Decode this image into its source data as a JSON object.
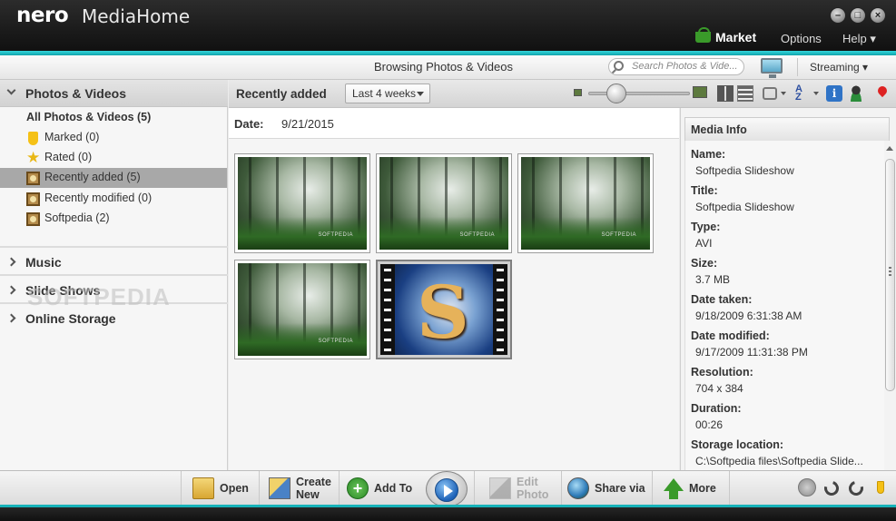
{
  "app": {
    "logo": "nero",
    "name": "MediaHome"
  },
  "menu": {
    "market": "Market",
    "options": "Options",
    "help": "Help ▾"
  },
  "header": {
    "breadcrumb": "Browsing Photos & Videos",
    "search_placeholder": "Search Photos & Vide...",
    "streaming": "Streaming ▾"
  },
  "sidebar": {
    "photos_videos": "Photos & Videos",
    "items": [
      {
        "label": "All Photos & Videos (5)",
        "icon": "none"
      },
      {
        "label": "Marked (0)",
        "icon": "tag-icon"
      },
      {
        "label": "Rated (0)",
        "icon": "star-icon"
      },
      {
        "label": "Recently added (5)",
        "icon": "album-icon",
        "selected": true
      },
      {
        "label": "Recently modified (0)",
        "icon": "album-icon"
      },
      {
        "label": "Softpedia (2)",
        "icon": "album-icon"
      }
    ],
    "music": "Music",
    "slide_shows": "Slide Shows",
    "online_storage": "Online Storage",
    "watermark": "SOFTPEDIA"
  },
  "toolbar": {
    "title": "Recently added",
    "period": "Last 4 weeks"
  },
  "main": {
    "date_label": "Date:",
    "date_value": "9/21/2015",
    "thumb_tag": "SOFTPEDIA"
  },
  "info": {
    "title": "Media Info",
    "fields": [
      {
        "key": "Name:",
        "value": "Softpedia Slideshow"
      },
      {
        "key": "Title:",
        "value": "Softpedia Slideshow"
      },
      {
        "key": "Type:",
        "value": "AVI"
      },
      {
        "key": "Size:",
        "value": "3.7 MB"
      },
      {
        "key": "Date taken:",
        "value": "9/18/2009 6:31:38 AM"
      },
      {
        "key": "Date modified:",
        "value": "9/17/2009 11:31:38 PM"
      },
      {
        "key": "Resolution:",
        "value": "704 x 384"
      },
      {
        "key": "Duration:",
        "value": "00:26"
      },
      {
        "key": "Storage location:",
        "value": "C:\\Softpedia files\\Softpedia Slide..."
      }
    ]
  },
  "bottom": {
    "open": "Open",
    "create_1": "Create",
    "create_2": "New",
    "add_to": "Add To",
    "edit_1": "Edit",
    "edit_2": "Photo",
    "share_via": "Share via",
    "more": "More"
  },
  "colors": {
    "accent_teal": "#16b2b8",
    "title_bar": "#1b1b1b",
    "selected_row": "#a8a8a8"
  }
}
